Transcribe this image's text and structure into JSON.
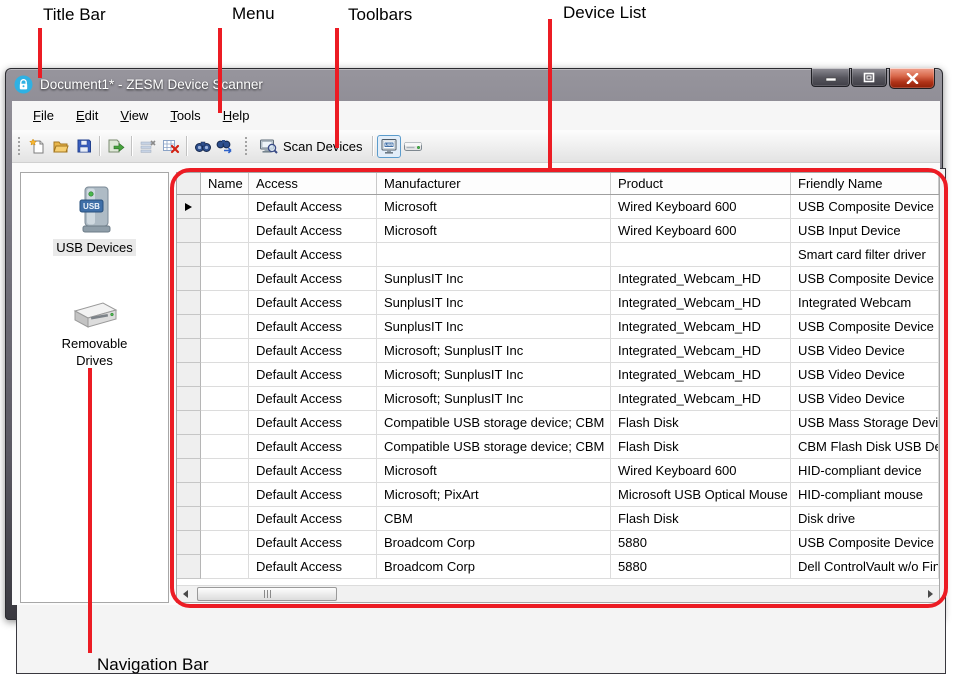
{
  "annotations": {
    "color": "#ec1c24",
    "labels": {
      "title_bar": "Title Bar",
      "menu": "Menu",
      "toolbars": "Toolbars",
      "device_list": "Device List",
      "navigation_bar": "Navigation Bar"
    }
  },
  "window": {
    "title": "Document1* - ZESM Device Scanner",
    "controls": [
      "minimize",
      "maximize",
      "close"
    ]
  },
  "menu": {
    "items": [
      {
        "accel": "F",
        "rest": "ile"
      },
      {
        "accel": "E",
        "rest": "dit"
      },
      {
        "accel": "V",
        "rest": "iew"
      },
      {
        "accel": "T",
        "rest": "ools"
      },
      {
        "accel": "H",
        "rest": "elp"
      }
    ]
  },
  "toolbar": {
    "buttons": [
      "new-document",
      "open-folder",
      "save",
      "export",
      "remove-row",
      "delete-grid",
      "find",
      "find-next"
    ],
    "scan_devices_label": "Scan Devices",
    "toggles": [
      {
        "name": "usb-devices",
        "active": true
      },
      {
        "name": "removable-drives",
        "active": false
      }
    ]
  },
  "sidebar": {
    "items": [
      {
        "label": "USB Devices",
        "selected": true
      },
      {
        "label": "Removable Drives",
        "selected": false
      }
    ]
  },
  "device_table": {
    "columns": [
      "Name",
      "Access",
      "Manufacturer",
      "Product",
      "Friendly Name"
    ],
    "rows": [
      {
        "current": true,
        "name": "",
        "access": "Default Access",
        "manufacturer": "Microsoft",
        "product": "Wired Keyboard 600",
        "friendly_name": "USB Composite Device"
      },
      {
        "current": false,
        "name": "",
        "access": "Default Access",
        "manufacturer": "Microsoft",
        "product": "Wired Keyboard 600",
        "friendly_name": "USB Input Device"
      },
      {
        "current": false,
        "name": "",
        "access": "Default Access",
        "manufacturer": "",
        "product": "",
        "friendly_name": "Smart card filter driver"
      },
      {
        "current": false,
        "name": "",
        "access": "Default Access",
        "manufacturer": "SunplusIT Inc",
        "product": "Integrated_Webcam_HD",
        "friendly_name": "USB Composite Device"
      },
      {
        "current": false,
        "name": "",
        "access": "Default Access",
        "manufacturer": "SunplusIT Inc",
        "product": "Integrated_Webcam_HD",
        "friendly_name": "Integrated Webcam"
      },
      {
        "current": false,
        "name": "",
        "access": "Default Access",
        "manufacturer": "SunplusIT Inc",
        "product": "Integrated_Webcam_HD",
        "friendly_name": "USB Composite Device"
      },
      {
        "current": false,
        "name": "",
        "access": "Default Access",
        "manufacturer": "Microsoft; SunplusIT Inc",
        "product": "Integrated_Webcam_HD",
        "friendly_name": "USB Video Device"
      },
      {
        "current": false,
        "name": "",
        "access": "Default Access",
        "manufacturer": "Microsoft; SunplusIT Inc",
        "product": "Integrated_Webcam_HD",
        "friendly_name": "USB Video Device"
      },
      {
        "current": false,
        "name": "",
        "access": "Default Access",
        "manufacturer": "Microsoft; SunplusIT Inc",
        "product": "Integrated_Webcam_HD",
        "friendly_name": "USB Video Device"
      },
      {
        "current": false,
        "name": "",
        "access": "Default Access",
        "manufacturer": "Compatible USB storage device; CBM",
        "product": "Flash Disk",
        "friendly_name": "USB Mass Storage Device"
      },
      {
        "current": false,
        "name": "",
        "access": "Default Access",
        "manufacturer": "Compatible USB storage device; CBM",
        "product": "Flash Disk",
        "friendly_name": "CBM Flash Disk USB Dev"
      },
      {
        "current": false,
        "name": "",
        "access": "Default Access",
        "manufacturer": "Microsoft",
        "product": "Wired Keyboard 600",
        "friendly_name": "HID-compliant device"
      },
      {
        "current": false,
        "name": "",
        "access": "Default Access",
        "manufacturer": "Microsoft; PixArt",
        "product": "Microsoft USB Optical Mouse",
        "friendly_name": "HID-compliant mouse"
      },
      {
        "current": false,
        "name": "",
        "access": "Default Access",
        "manufacturer": "CBM",
        "product": "Flash Disk",
        "friendly_name": "Disk drive"
      },
      {
        "current": false,
        "name": "",
        "access": "Default Access",
        "manufacturer": "Broadcom Corp",
        "product": "5880",
        "friendly_name": "USB Composite Device"
      },
      {
        "current": false,
        "name": "",
        "access": "Default Access",
        "manufacturer": "Broadcom Corp",
        "product": "5880",
        "friendly_name": "Dell ControlVault w/o Fin"
      }
    ]
  },
  "colors": {
    "annotation_red": "#ec1c24",
    "toggle_active_border": "#5c9ccc",
    "close_button_red": "#b03318",
    "app_icon_blue": "#2fb1e3"
  }
}
